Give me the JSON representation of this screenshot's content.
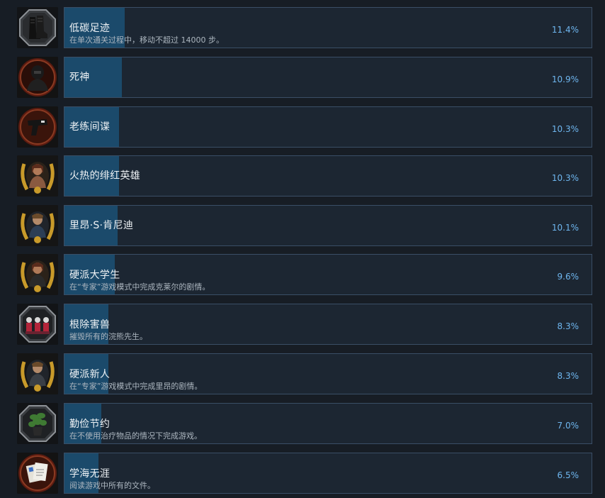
{
  "achievements": [
    {
      "title": "低碳足迹",
      "description": "在单次通关过程中，移动不超过 14000 步。",
      "percent_label": "11.4%",
      "percent": 11.4,
      "icon": "boots-icon"
    },
    {
      "title": "死神",
      "description": "",
      "percent_label": "10.9%",
      "percent": 10.9,
      "icon": "masked-soldier-icon"
    },
    {
      "title": "老练间谍",
      "description": "",
      "percent_label": "10.3%",
      "percent": 10.3,
      "icon": "handgun-icon"
    },
    {
      "title": "火热的绯红英雄",
      "description": "",
      "percent_label": "10.3%",
      "percent": 10.3,
      "icon": "claire-laurel-icon"
    },
    {
      "title": "里昂·S·肯尼迪",
      "description": "",
      "percent_label": "10.1%",
      "percent": 10.1,
      "icon": "leon-laurel-icon"
    },
    {
      "title": "硬派大学生",
      "description": "在“专家”游戏模式中完成克莱尔的剧情。",
      "percent_label": "9.6%",
      "percent": 9.6,
      "icon": "claire-laurel-icon"
    },
    {
      "title": "根除害兽",
      "description": "摧毁所有的浣熊先生。",
      "percent_label": "8.3%",
      "percent": 8.3,
      "icon": "raccoon-figures-icon"
    },
    {
      "title": "硬派新人",
      "description": "在“专家”游戏模式中完成里昂的剧情。",
      "percent_label": "8.3%",
      "percent": 8.3,
      "icon": "leon-laurel-icon"
    },
    {
      "title": "勤俭节约",
      "description": "在不使用治疗物品的情况下完成游戏。",
      "percent_label": "7.0%",
      "percent": 7.0,
      "icon": "green-herb-icon"
    },
    {
      "title": "学海无涯",
      "description": "阅读游戏中所有的文件。",
      "percent_label": "6.5%",
      "percent": 6.5,
      "icon": "documents-icon"
    }
  ],
  "colors": {
    "background": "#171d25",
    "bar": "#1c2632",
    "bar_border": "#3a4e66",
    "progress": "#1b4a6b",
    "percent_text": "#6eb6ef",
    "title_text": "#eef2f5",
    "desc_text": "#acb6bf"
  }
}
